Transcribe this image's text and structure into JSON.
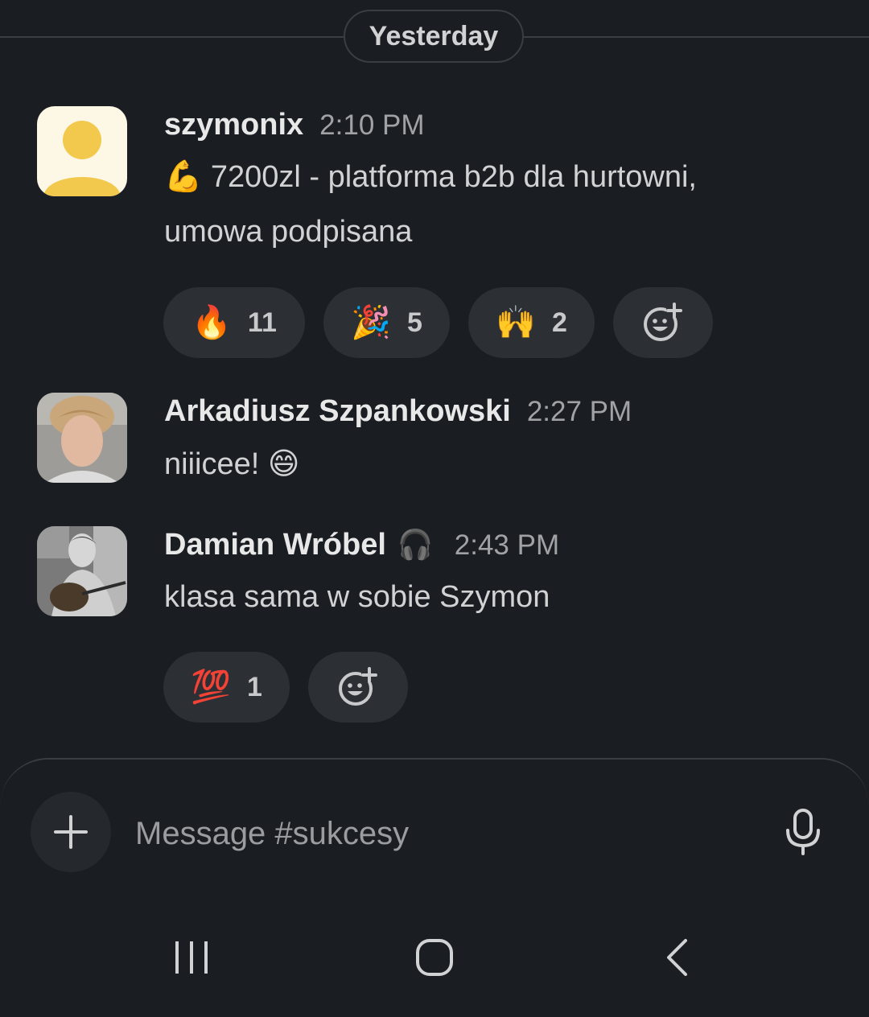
{
  "day_divider": "Yesterday",
  "messages": [
    {
      "author": "szymonix",
      "time": "2:10 PM",
      "text_line1": "💪 7200zl - platforma b2b dla hurtowni,",
      "text_line2": "umowa podpisana",
      "reactions": [
        {
          "emoji": "🔥",
          "count": "11"
        },
        {
          "emoji": "🎉",
          "count": "5"
        },
        {
          "emoji": "🙌",
          "count": "2"
        }
      ]
    },
    {
      "author": "Arkadiusz Szpankowski",
      "time": "2:27 PM",
      "text": "niiicee! 😄"
    },
    {
      "author": "Damian Wróbel",
      "status_emoji": "🎧",
      "time": "2:43 PM",
      "text": "klasa sama w sobie Szymon",
      "reactions": [
        {
          "emoji": "💯",
          "count": "1"
        }
      ]
    }
  ],
  "composer": {
    "placeholder": "Message #sukcesy"
  },
  "icons": {
    "add_reaction": "add-reaction-icon",
    "plus": "plus-icon",
    "mic": "microphone-icon",
    "recents": "recent-apps-icon",
    "home": "home-icon",
    "back": "back-icon"
  },
  "colors": {
    "background": "#1a1d21",
    "pill": "#2c2f34",
    "default_avatar_bg": "#fdf8e6",
    "default_avatar_fg": "#f2c94c"
  }
}
